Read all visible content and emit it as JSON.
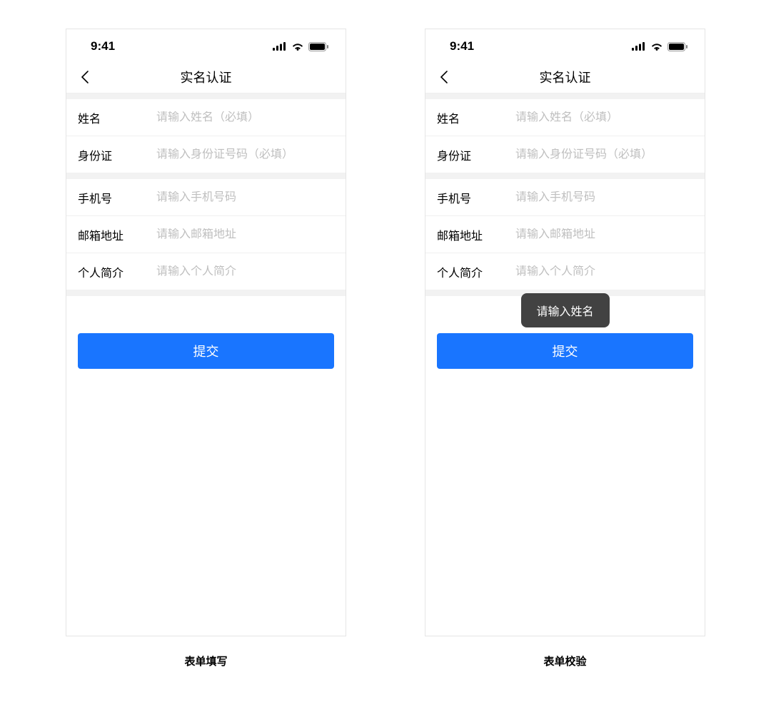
{
  "status": {
    "time": "9:41"
  },
  "nav": {
    "title": "实名认证"
  },
  "fields": {
    "name": {
      "label": "姓名",
      "placeholder": "请输入姓名（必填）"
    },
    "idcard": {
      "label": "身份证",
      "placeholder": "请输入身份证号码（必填）"
    },
    "phone": {
      "label": "手机号",
      "placeholder": "请输入手机号码"
    },
    "email": {
      "label": "邮箱地址",
      "placeholder": "请输入邮箱地址"
    },
    "bio": {
      "label": "个人简介",
      "placeholder": "请输入个人简介"
    }
  },
  "submit": {
    "label": "提交"
  },
  "toast": {
    "message": "请输入姓名"
  },
  "captions": {
    "left": "表单填写",
    "right": "表单校验"
  }
}
